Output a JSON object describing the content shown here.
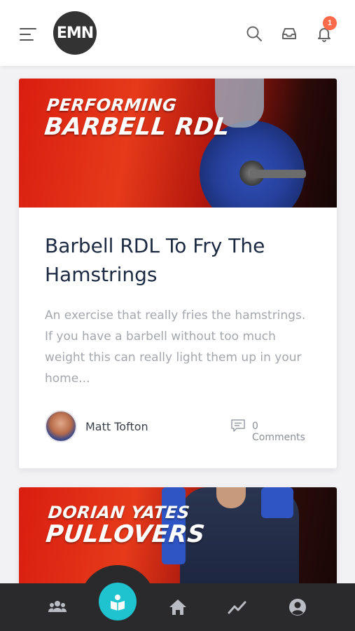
{
  "header": {
    "logo_text": "EMN",
    "notification_count": "1"
  },
  "posts": [
    {
      "hero_line1": "PERFORMING",
      "hero_line2": "BARBELL RDL",
      "title": "Barbell RDL To Fry The Hamstrings",
      "excerpt": "An exercise that really fries the hamstrings. If you have a barbell without too much weight this can really light them up in your home...",
      "author": "Matt Tofton",
      "comments": "0 Comments"
    },
    {
      "hero_line1": "DORIAN YATES",
      "hero_line2": "PULLOVERS"
    }
  ],
  "bottom_nav": {
    "items": [
      "community-icon",
      "learn-icon",
      "home-icon",
      "progress-icon",
      "profile-icon"
    ],
    "active": "learn-icon",
    "accent": "#1ec3cf"
  },
  "colors": {
    "hero_red": "#e63a1a",
    "title": "#1b2942",
    "excerpt": "#a4a7ad",
    "badge": "#ff6b4a",
    "nav_bg": "#2a2a2c"
  }
}
